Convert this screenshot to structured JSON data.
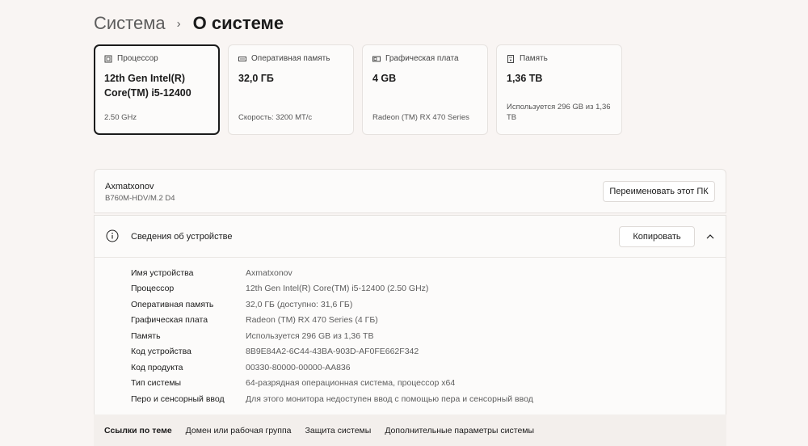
{
  "breadcrumb": {
    "parent": "Система",
    "separator": "›",
    "current": "О системе"
  },
  "cards": [
    {
      "title": "Процессор",
      "value": "12th Gen Intel(R) Core(TM) i5-12400",
      "sub": "2.50 GHz",
      "icon": "processor-icon"
    },
    {
      "title": "Оперативная память",
      "value": "32,0 ГБ",
      "sub": "Скорость: 3200 МТ/с",
      "icon": "ram-icon"
    },
    {
      "title": "Графическая плата",
      "value": "4 GB",
      "sub": "Radeon (TM) RX 470 Series",
      "icon": "graphics-card-icon"
    },
    {
      "title": "Память",
      "value": "1,36 TB",
      "sub": "Используется 296 GB из 1,36 ТВ",
      "icon": "storage-icon"
    }
  ],
  "pc": {
    "name": "Axmatxonov",
    "model": "B760M-HDV/M.2 D4",
    "rename_label": "Переименовать этот ПК"
  },
  "device_specs": {
    "title": "Сведения об устройстве",
    "copy_label": "Копировать",
    "rows": [
      {
        "label": "Имя устройства",
        "value": "Axmatxonov"
      },
      {
        "label": "Процессор",
        "value": "12th Gen Intel(R) Core(TM) i5-12400 (2.50 GHz)"
      },
      {
        "label": "Оперативная память",
        "value": "32,0 ГБ (доступно: 31,6 ГБ)"
      },
      {
        "label": "Графическая плата",
        "value": "Radeon (TM) RX 470 Series (4 ГБ)"
      },
      {
        "label": "Память",
        "value": "Используется 296 GB из 1,36 ТВ"
      },
      {
        "label": "Код устройства",
        "value": "8B9E84A2-6C44-43BA-903D-AF0FE662F342"
      },
      {
        "label": "Код продукта",
        "value": "00330-80000-00000-AA836"
      },
      {
        "label": "Тип системы",
        "value": "64-разрядная операционная система, процессор x64"
      },
      {
        "label": "Перо и сенсорный ввод",
        "value": "Для этого монитора недоступен ввод с помощью пера и сенсорный ввод"
      }
    ]
  },
  "related": {
    "title": "Ссылки по теме",
    "links": [
      "Домен или рабочая группа",
      "Защита системы",
      "Дополнительные параметры системы"
    ]
  }
}
